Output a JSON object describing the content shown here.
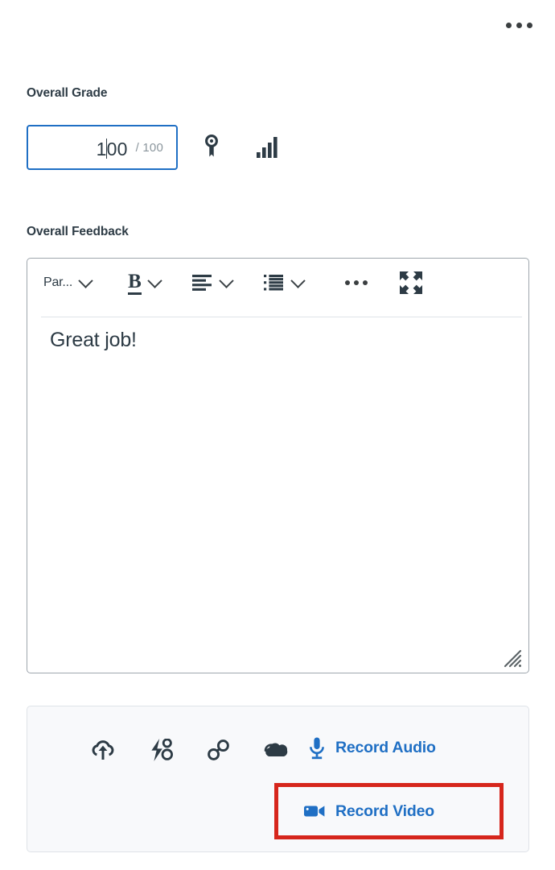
{
  "header": {
    "overflow_menu_label": "More options",
    "overflow_menu_icon": "kebab-menu-icon"
  },
  "grade": {
    "label": "Overall Grade",
    "value": "100",
    "value_before_caret": "1",
    "value_after_caret": "00",
    "out_of": "/ 100",
    "points_possible": 100,
    "rubric_icon": "rubric-award-icon",
    "statistics_icon": "bar-chart-statistics-icon",
    "focus_border_color": "#1f6fc4"
  },
  "feedback": {
    "label": "Overall Feedback",
    "body_text": "Great job!",
    "toolbar": {
      "paragraph_format_label": "Par...",
      "bold_label": "B",
      "align_icon": "align-left-icon",
      "list_icon": "bulleted-list-icon",
      "more_label": "More formatting options",
      "more_icon": "ellipsis-icon",
      "fullscreen_icon": "expand-fullscreen-icon"
    },
    "resize_handle_icon": "resize-grip-icon"
  },
  "attachments": {
    "icons": [
      {
        "name": "upload-cloud-icon",
        "label": "Upload file"
      },
      {
        "name": "lightning-bolt-icon",
        "label": "Insert stuff"
      },
      {
        "name": "link-chain-icon",
        "label": "Insert link"
      },
      {
        "name": "cloud-storage-icon",
        "label": "Cloud storage"
      }
    ],
    "record_audio": {
      "label": "Record Audio",
      "icon": "microphone-icon"
    },
    "record_video": {
      "label": "Record Video",
      "icon": "video-camera-icon",
      "highlighted": true,
      "highlight_color": "#d6261c"
    },
    "link_color": "#1f6fc4",
    "panel_background": "#f8f9fb"
  }
}
